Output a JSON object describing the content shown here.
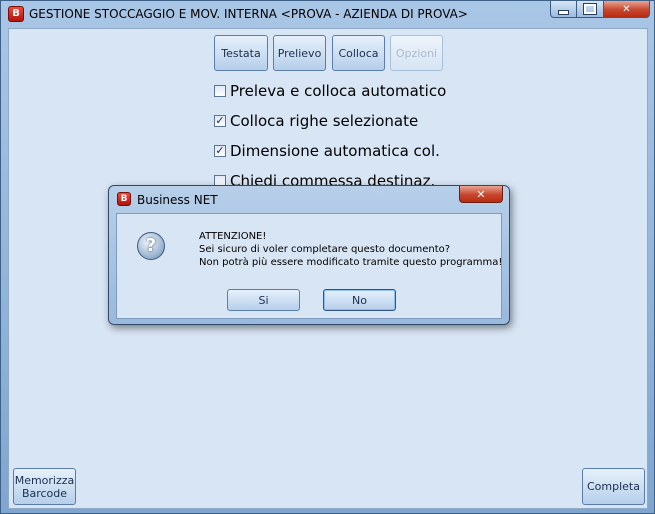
{
  "window": {
    "app_icon": "business-net-icon",
    "title": "GESTIONE STOCCAGGIO E MOV. INTERNA <PROVA - AZIENDA DI PROVA>",
    "minimize_icon": "minimize-icon",
    "maximize_icon": "maximize-icon",
    "close_glyph": "✕"
  },
  "tabs": [
    {
      "label": "Testata",
      "enabled": true
    },
    {
      "label": "Prelievo",
      "enabled": true
    },
    {
      "label": "Colloca",
      "enabled": true
    },
    {
      "label": "Opzioni",
      "enabled": false
    }
  ],
  "options": [
    {
      "label": "Preleva e colloca automatico",
      "checked": false
    },
    {
      "label": "Colloca righe selezionate",
      "checked": true
    },
    {
      "label": "Dimensione automatica col.",
      "checked": true
    },
    {
      "label": "Chiedi commessa destinaz.",
      "checked": false
    }
  ],
  "buttons": {
    "memorizza_line1": "Memorizza",
    "memorizza_line2": "Barcode",
    "completa": "Completa"
  },
  "dialog": {
    "title": "Business NET",
    "close_glyph": "✕",
    "icon": "question-icon",
    "line1": "ATTENZIONE!",
    "line2": "Sei sicuro di voler completare questo documento?",
    "line3": "Non potrà più essere modificato tramite questo programma!",
    "yes_label": "Si",
    "no_label": "No"
  },
  "colors": {
    "accent": "#7fa6d0",
    "client_bg": "#d8e5f4",
    "close_red": "#c8462d"
  }
}
